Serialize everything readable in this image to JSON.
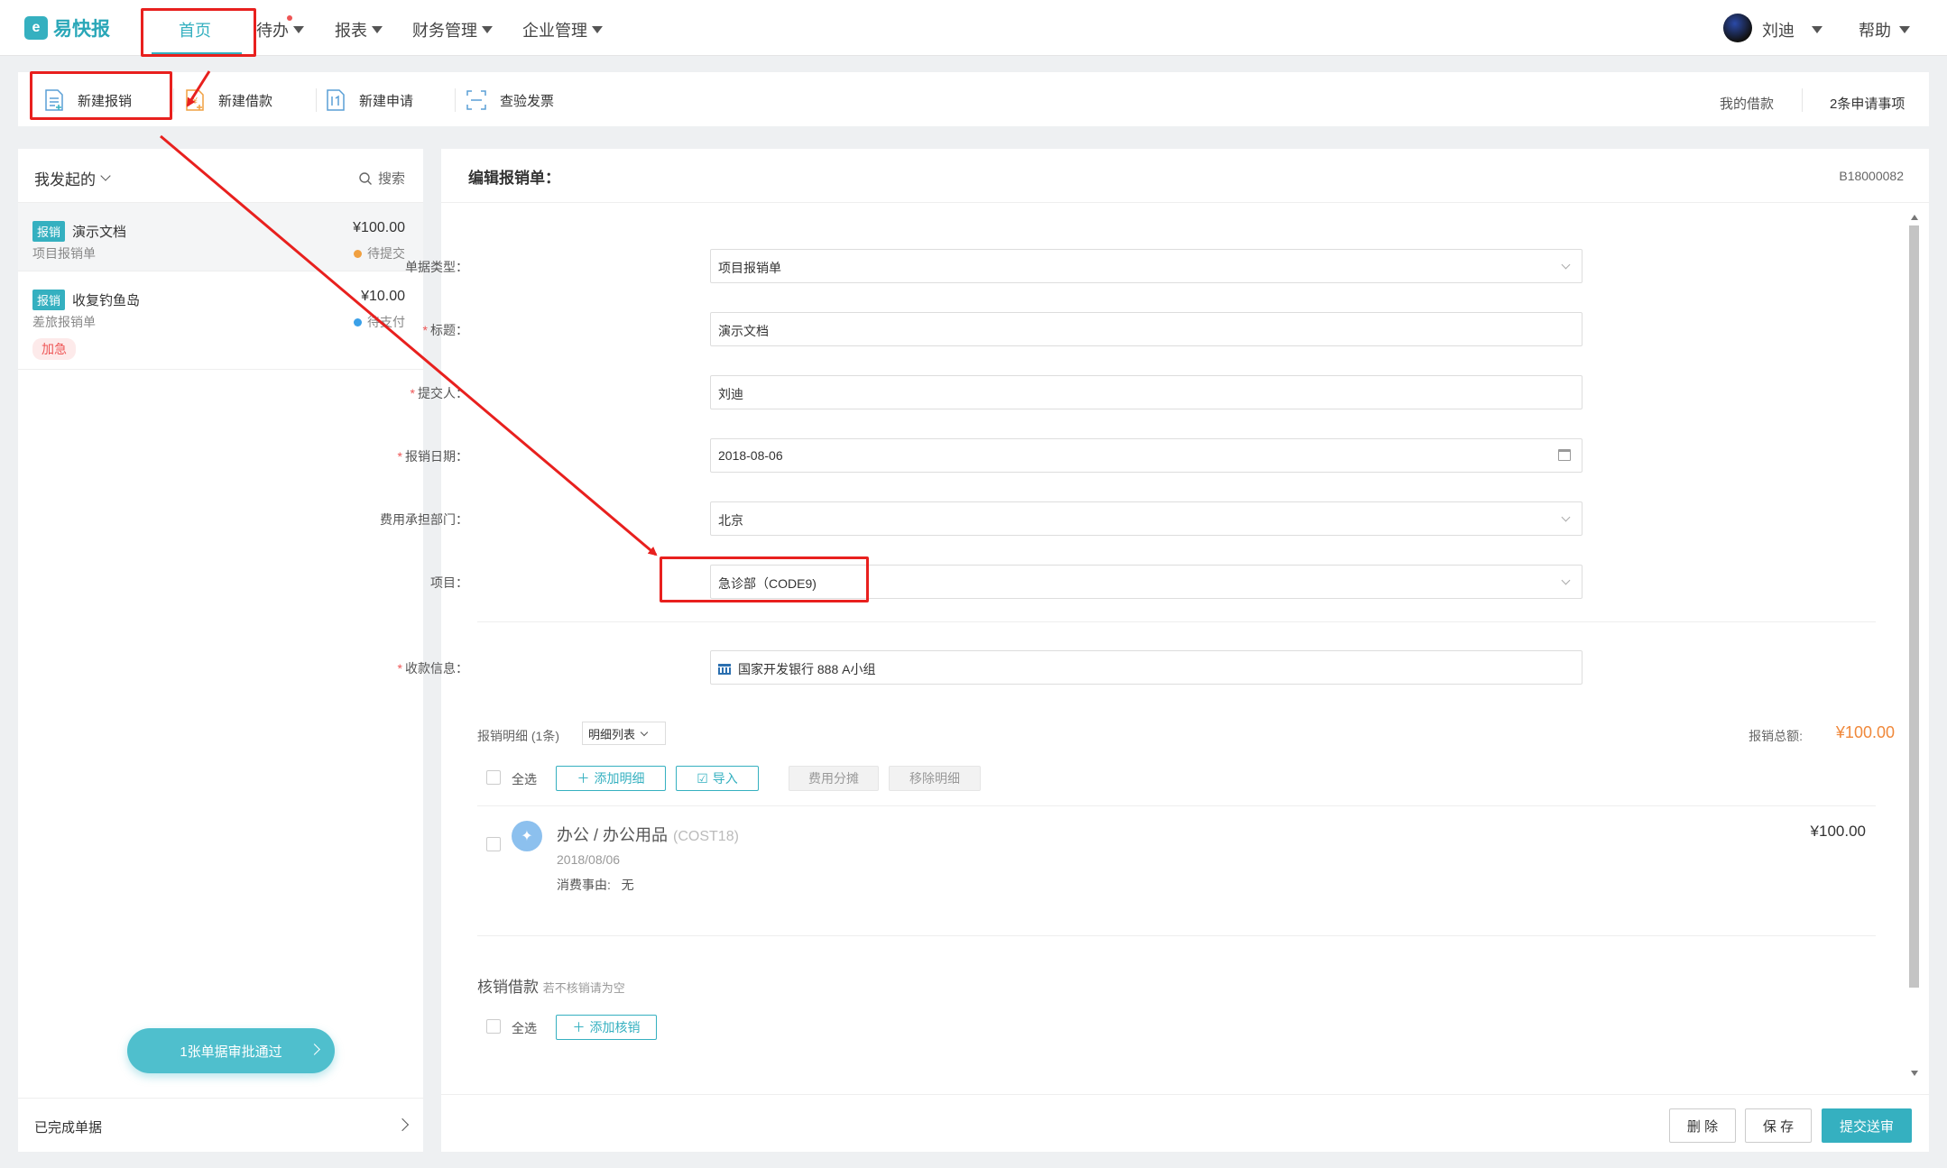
{
  "app": {
    "name": "易快报",
    "logo_char": "e"
  },
  "nav": {
    "items": [
      {
        "label": "首页",
        "active": true
      },
      {
        "label": "待办",
        "has_dot": true
      },
      {
        "label": "报表"
      },
      {
        "label": "财务管理"
      },
      {
        "label": "企业管理"
      }
    ],
    "user_name": "刘迪",
    "help_label": "帮助"
  },
  "toolbar": {
    "new_expense": "新建报销",
    "new_loan": "新建借款",
    "new_request": "新建申请",
    "check_invoice": "查验发票",
    "my_loans": "我的借款",
    "pending_requests": "2条申请事项"
  },
  "left_panel": {
    "title": "我发起的",
    "search_label": "搜索",
    "documents": [
      {
        "tag": "报销",
        "title": "演示文档",
        "type": "项目报销单",
        "amount": "¥100.00",
        "status": "待提交",
        "status_color": "#f0a040",
        "urgent": ""
      },
      {
        "tag": "报销",
        "title": "收复钓鱼岛",
        "type": "差旅报销单",
        "amount": "¥10.00",
        "status": "待支付",
        "status_color": "#3aa0e8",
        "urgent": "加急"
      }
    ],
    "approve_button": "1张单据审批通过",
    "completed_label": "已完成单据"
  },
  "main": {
    "title": "编辑报销单：",
    "doc_code": "B18000082",
    "fields": {
      "doc_type": {
        "label": "单据类型：",
        "value": "项目报销单"
      },
      "title": {
        "label": "标题：",
        "value": "演示文档"
      },
      "submitter": {
        "label": "提交人：",
        "value": "刘迪"
      },
      "date": {
        "label": "报销日期：",
        "value": "2018-08-06"
      },
      "dept": {
        "label": "费用承担部门：",
        "value": "北京"
      },
      "project": {
        "label": "项目：",
        "value": "急诊部（CODE9)"
      },
      "payee": {
        "label": "收款信息：",
        "value": "国家开发银行 888 A小组"
      }
    },
    "details": {
      "label": "报销明细",
      "count": "(1条)",
      "view": "明细列表",
      "total_label": "报销总额:",
      "total_value": "¥100.00",
      "select_all": "全选",
      "add_detail": "添加明细",
      "import": "导入",
      "split": "费用分摊",
      "remove": "移除明细",
      "items": [
        {
          "name": "办公 / 办公用品",
          "code": "(COST18)",
          "date": "2018/08/06",
          "reason_label": "消费事由:",
          "reason": "无",
          "amount": "¥100.00"
        }
      ]
    },
    "writeoff": {
      "label": "核销借款",
      "hint": "若不核销请为空",
      "select_all": "全选",
      "add": "添加核销"
    },
    "footer": {
      "delete": "删 除",
      "save": "保 存",
      "submit": "提交送审"
    }
  },
  "annotation_color": "#e8201e"
}
